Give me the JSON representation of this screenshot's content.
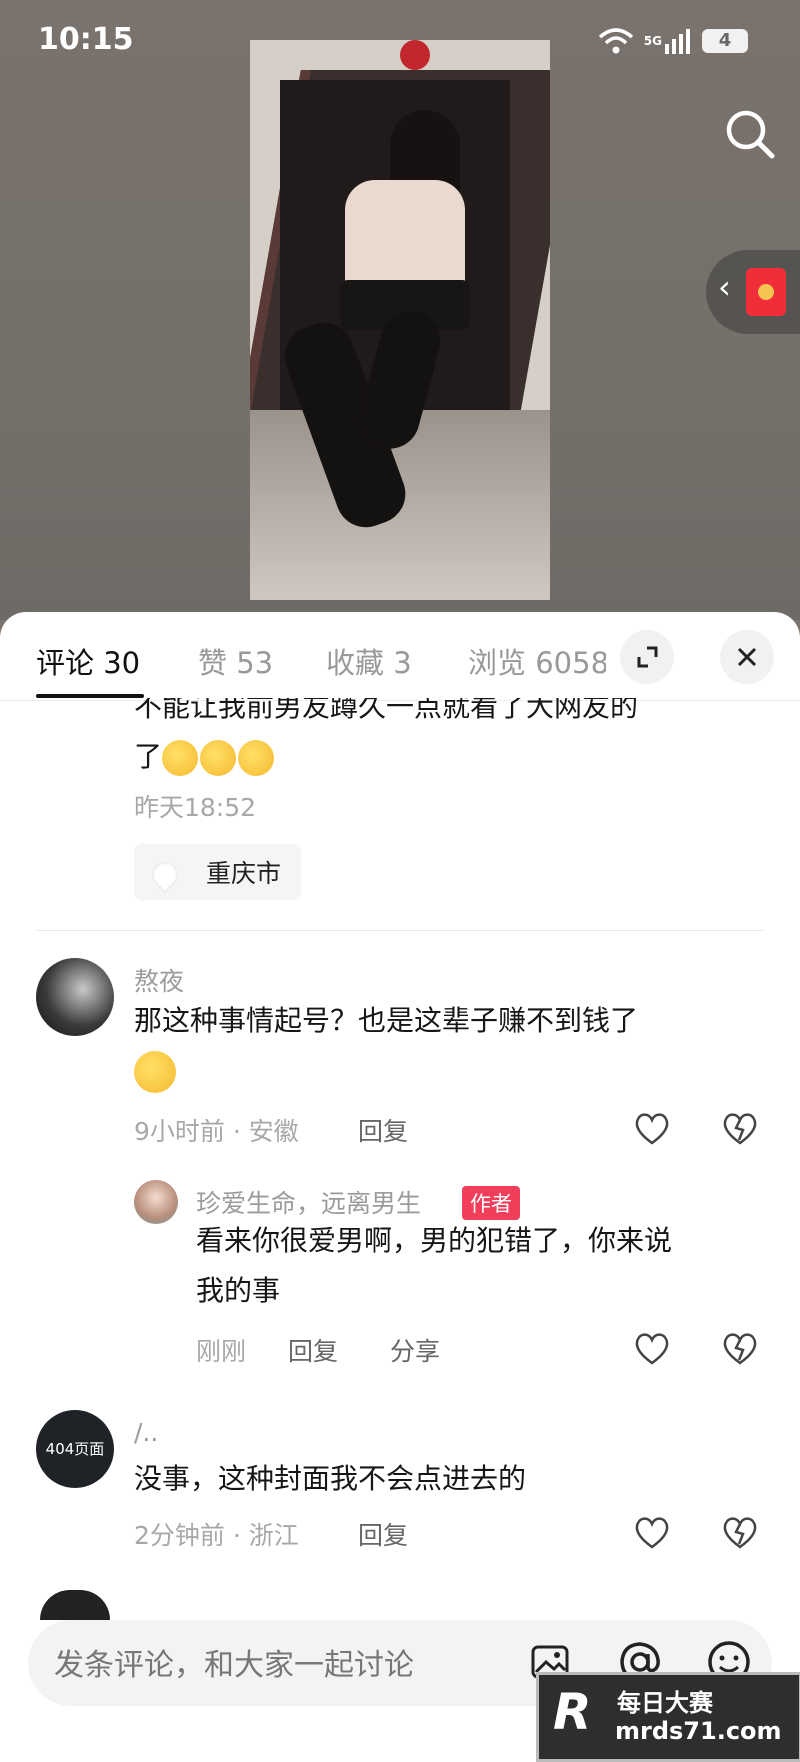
{
  "status_bar": {
    "time": "10:15",
    "network": "5G",
    "battery": "4"
  },
  "comment_tabs": [
    {
      "label": "评论 30"
    },
    {
      "label": "赞 53"
    },
    {
      "label": "收藏 3"
    },
    {
      "label": "浏览 6058"
    }
  ],
  "comments": [
    {
      "text_line1": "不能让我前男友蹲久一点就看了大网友的",
      "text_line2": "了",
      "time": "昨天18:52",
      "location_chip": "重庆市"
    },
    {
      "username": "熬夜",
      "text": "那这种事情起号？也是这辈子赚不到钱了",
      "meta": "9小时前 · 安徽",
      "reply_label": "回复",
      "reply": {
        "username": "珍爱生命，远离男生",
        "author_badge": "作者",
        "text_line1": "看来你很爱男啊，男的犯错了，你来说",
        "text_line2": "我的事",
        "time": "刚刚",
        "reply_label": "回复",
        "share_label": "分享"
      }
    },
    {
      "username": "/..",
      "avatar_text": "404页面",
      "text": "没事，这种封面我不会点进去的",
      "meta": "2分钟前 · 浙江",
      "reply_label": "回复"
    }
  ],
  "input": {
    "placeholder": "发条评论，和大家一起讨论"
  },
  "watermark": {
    "title": "每日大赛",
    "url": "mrds71.com"
  },
  "colors": {
    "author_badge": "#f03e5b",
    "red_packet": "#ef2e3a"
  }
}
